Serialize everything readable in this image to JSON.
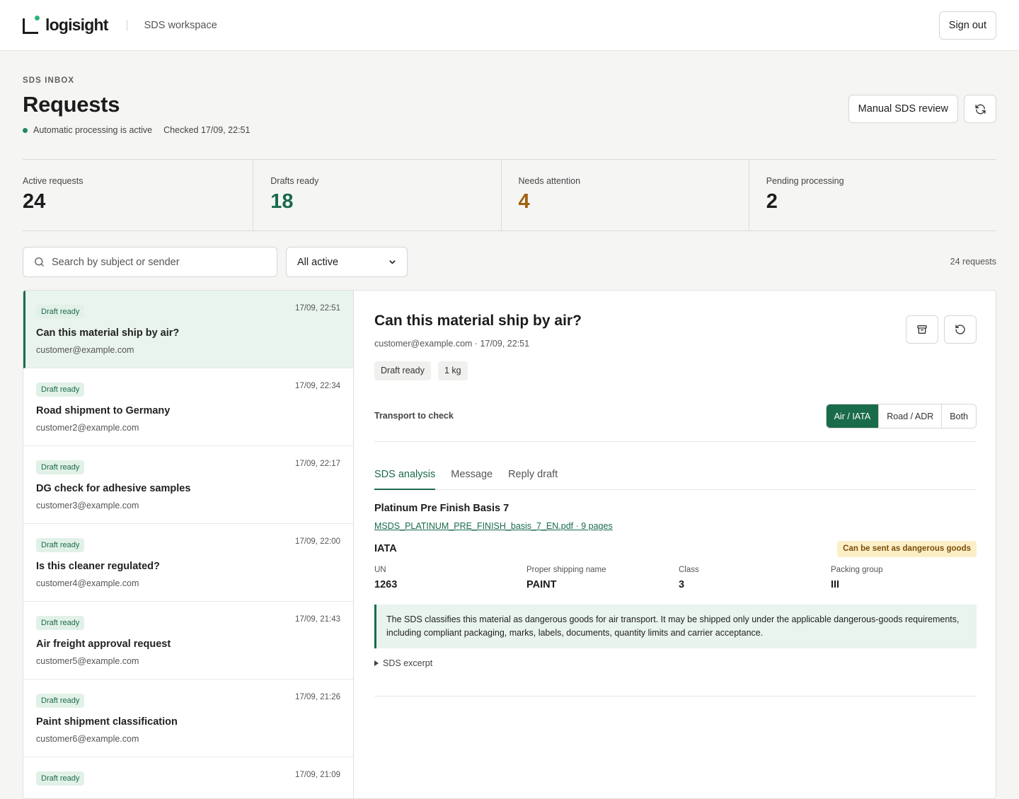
{
  "topbar": {
    "logo_text": "logisight",
    "workspace": "SDS workspace",
    "signout_label": "Sign out"
  },
  "header": {
    "eyebrow": "SDS INBOX",
    "title": "Requests",
    "status": "Automatic processing is active",
    "checked": "Checked 17/09, 22:51",
    "manual_review_label": "Manual SDS review"
  },
  "stats": [
    {
      "label": "Active requests",
      "value": "24"
    },
    {
      "label": "Drafts ready",
      "value": "18"
    },
    {
      "label": "Needs attention",
      "value": "4"
    },
    {
      "label": "Pending processing",
      "value": "2"
    }
  ],
  "filters": {
    "search_placeholder": "Search by subject or sender",
    "filter_value": "All active",
    "count": "24 requests"
  },
  "requests": [
    {
      "badge": "Draft ready",
      "time": "17/09, 22:51",
      "subject": "Can this material ship by air?",
      "sender": "customer@example.com"
    },
    {
      "badge": "Draft ready",
      "time": "17/09, 22:34",
      "subject": "Road shipment to Germany",
      "sender": "customer2@example.com"
    },
    {
      "badge": "Draft ready",
      "time": "17/09, 22:17",
      "subject": "DG check for adhesive samples",
      "sender": "customer3@example.com"
    },
    {
      "badge": "Draft ready",
      "time": "17/09, 22:00",
      "subject": "Is this cleaner regulated?",
      "sender": "customer4@example.com"
    },
    {
      "badge": "Draft ready",
      "time": "17/09, 21:43",
      "subject": "Air freight approval request",
      "sender": "customer5@example.com"
    },
    {
      "badge": "Draft ready",
      "time": "17/09, 21:26",
      "subject": "Paint shipment classification",
      "sender": "customer6@example.com"
    },
    {
      "badge": "Draft ready",
      "time": "17/09, 21:09",
      "subject": "",
      "sender": ""
    }
  ],
  "detail": {
    "title": "Can this material ship by air?",
    "meta": "customer@example.com · 17/09, 22:51",
    "tags": [
      "Draft ready",
      "1 kg"
    ],
    "transport_label": "Transport to check",
    "transport_options": [
      "Air / IATA",
      "Road / ADR",
      "Both"
    ],
    "tabs": [
      "SDS analysis",
      "Message",
      "Reply draft"
    ],
    "product": "Platinum Pre Finish Basis 7",
    "file": "MSDS_PLATINUM_PRE_FINISH_basis_7_EN.pdf · 9 pages",
    "regulation": "IATA",
    "verdict": "Can be sent as dangerous goods",
    "fields": [
      {
        "label": "UN",
        "value": "1263"
      },
      {
        "label": "Proper shipping name",
        "value": "PAINT"
      },
      {
        "label": "Class",
        "value": "3"
      },
      {
        "label": "Packing group",
        "value": "III"
      }
    ],
    "note": "The SDS classifies this material as dangerous goods for air transport. It may be shipped only under the applicable dangerous-goods requirements, including compliant packaging, marks, labels, documents, quantity limits and carrier acceptance.",
    "excerpt_label": "SDS excerpt"
  },
  "colors": {
    "accent": "#1a6b4a",
    "amber": "#a0620f",
    "logo_dot": "#2bb57b"
  }
}
